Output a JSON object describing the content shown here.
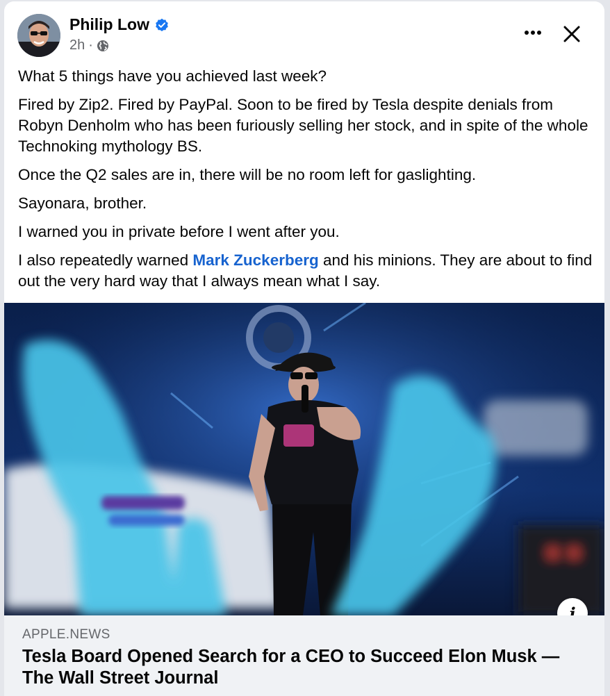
{
  "post": {
    "author": "Philip Low",
    "time": "2h",
    "separator": "·",
    "paragraphs": {
      "p1": "What 5 things have you achieved last week?",
      "p2": "Fired by Zip2. Fired by PayPal. Soon to be fired by Tesla despite denials from Robyn Denholm who has been furiously selling her stock, and in spite of the whole Technoking mythology BS.",
      "p3": "Once the Q2 sales are in, there will be no room left for gaslighting.",
      "p4": "Sayonara, brother.",
      "p5": "I warned you in private before I went after you.",
      "p6_before": "I also repeatedly warned ",
      "p6_mention": "Mark Zuckerberg",
      "p6_after": " and his minions. They are about to find out the very hard way that I always mean what I say."
    }
  },
  "link": {
    "source": "APPLE.NEWS",
    "headline": "Tesla Board Opened Search for a CEO to Succeed Elon Musk — The Wall Street Journal"
  },
  "icons": {
    "verified": "verified-badge-icon",
    "privacy": "globe-icon",
    "more": "more-icon",
    "close": "close-icon",
    "info": "info-icon"
  },
  "colors": {
    "mention": "#1763cf",
    "verified": "#1877f2",
    "secondary_text": "#65676b",
    "preview_bg": "#f0f2f5"
  }
}
